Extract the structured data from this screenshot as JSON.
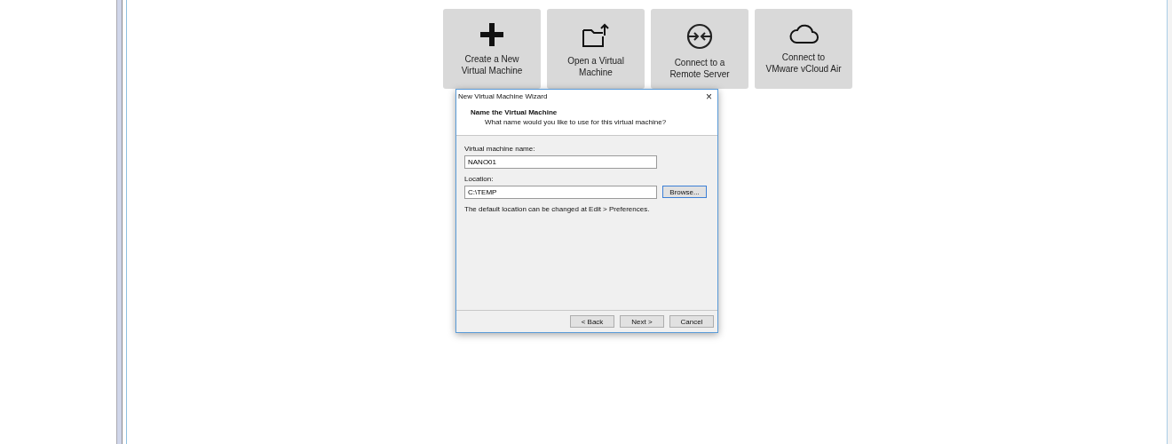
{
  "tiles": [
    {
      "kind": "plus",
      "label": "Create a New\nVirtual Machine"
    },
    {
      "kind": "folder-upload",
      "label": "Open a Virtual\nMachine"
    },
    {
      "kind": "remote",
      "label": "Connect to a\nRemote Server"
    },
    {
      "kind": "cloud",
      "label": "Connect to\nVMware vCloud Air"
    }
  ],
  "dialog": {
    "title": "New Virtual Machine Wizard",
    "close": "×",
    "heading": "Name the Virtual Machine",
    "subheading": "What name would you like to use for this virtual machine?",
    "fields": [
      {
        "label": "Virtual machine name:",
        "value": "NANO01"
      },
      {
        "label": "Location:",
        "value": "C:\\TEMP",
        "button": "Browse..."
      }
    ],
    "hint": "The default location can be changed at Edit > Preferences.",
    "buttons": [
      "< Back",
      "Next >",
      "Cancel"
    ]
  }
}
